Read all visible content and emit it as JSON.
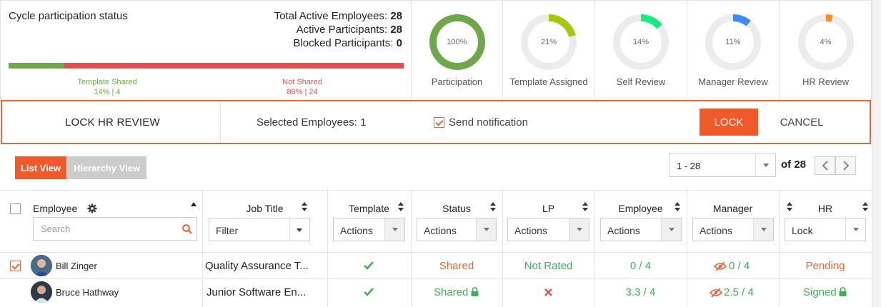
{
  "summary": {
    "title": "Cycle participation status",
    "total_active_label": "Total Active Employees:",
    "total_active_value": "28",
    "active_participants_label": "Active Participants:",
    "active_participants_value": "28",
    "blocked_label": "Blocked Participants:",
    "blocked_value": "0",
    "shared_fraction": 0.14,
    "template_shared_label": "Template Shared",
    "template_shared_value": "14% | 4",
    "not_shared_label": "Not Shared",
    "not_shared_value": "86% | 24"
  },
  "donuts": [
    {
      "pct_text": "100%",
      "fraction": 1.0,
      "color": "#6fa84a",
      "label": "Participation"
    },
    {
      "pct_text": "21%",
      "fraction": 0.21,
      "color": "#a6c90f",
      "label": "Template Assigned"
    },
    {
      "pct_text": "14%",
      "fraction": 0.14,
      "color": "#1de983",
      "label": "Self Review"
    },
    {
      "pct_text": "11%",
      "fraction": 0.11,
      "color": "#3d8ef0",
      "label": "Manager Review"
    },
    {
      "pct_text": "4%",
      "fraction": 0.04,
      "color": "#f7941d",
      "label": "HR Review"
    }
  ],
  "lockbar": {
    "title": "LOCK HR REVIEW",
    "selected_label": "Selected Employees: 1",
    "notify_label": "Send notification",
    "notify_checked": true,
    "lock_label": "LOCK",
    "cancel_label": "CANCEL"
  },
  "views": {
    "list_label": "List View",
    "hierarchy_label": "Hierarchy View"
  },
  "pager": {
    "range": "1 - 28",
    "of_label": "of 28"
  },
  "table": {
    "headers": {
      "employee": "Employee",
      "job_title": "Job Title",
      "template": "Template",
      "status": "Status",
      "lp": "LP",
      "employee_review": "Employee",
      "manager": "Manager",
      "hr": "HR"
    },
    "search_placeholder": "Search",
    "filters": {
      "job_title": "Filter",
      "template": "Actions",
      "status": "Actions",
      "lp": "Actions",
      "employee_review": "Actions",
      "manager": "Actions",
      "hr": "Lock"
    },
    "rows": [
      {
        "checked": true,
        "name": "Bill Zinger",
        "job_title": "Quality Assurance T...",
        "template": "check",
        "status": "Shared",
        "status_locked": false,
        "lp": "Not Rated",
        "employee_score": "0 / 4",
        "manager_score": "0 / 4",
        "hr": "Pending",
        "hr_locked": false
      },
      {
        "checked": false,
        "name": "Bruce Hathway",
        "job_title": "Junior Software En...",
        "template": "check",
        "status": "Shared",
        "status_locked": true,
        "lp": "x",
        "employee_score": "3.3 / 4",
        "manager_score": "2.5 / 4",
        "hr": "Signed",
        "hr_locked": true
      }
    ]
  },
  "colors": {
    "accent": "#f05a2a",
    "green": "#3fae5a",
    "red": "#e05252"
  }
}
